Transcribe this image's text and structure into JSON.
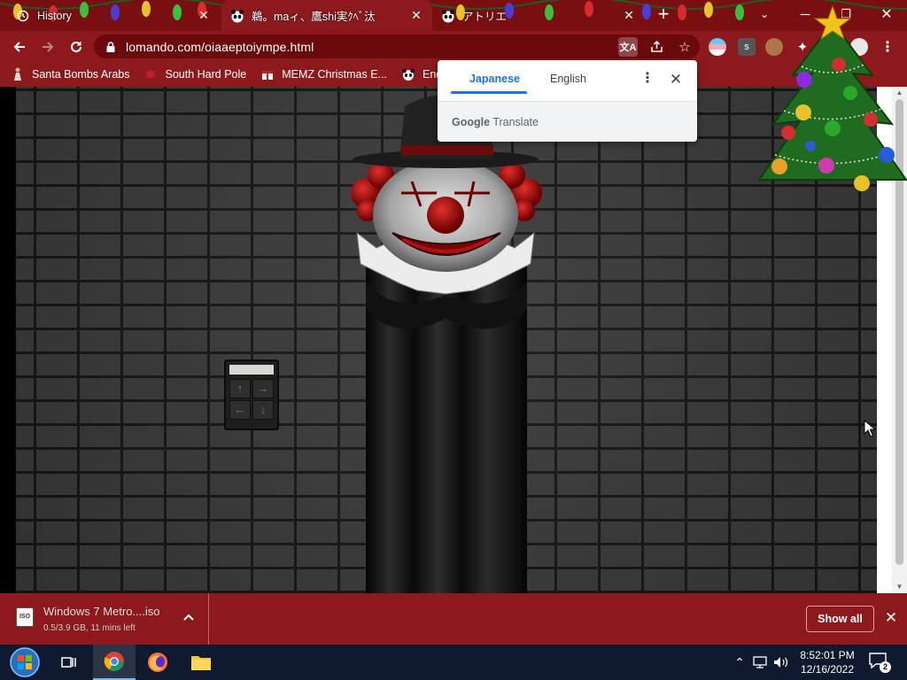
{
  "browser": {
    "tabs": [
      {
        "title": "History",
        "icon": "history-icon",
        "active": false
      },
      {
        "title": "鵜。maィ、鷹shi実ｸﾍﾞ汰",
        "icon": "panda-favicon",
        "active": true
      },
      {
        "title": "アトリエ",
        "icon": "panda-favicon",
        "active": false
      }
    ],
    "address": {
      "url": "lomando.com/oiaaeptoiympe.html"
    },
    "bookmarks": [
      {
        "label": "Santa Bombs Arabs",
        "icon": "figure-icon"
      },
      {
        "label": "South Hard Pole",
        "icon": "bug-icon"
      },
      {
        "label": "MEMZ Christmas E...",
        "icon": "gift-icon"
      },
      {
        "label": "Enderm",
        "icon": "panda-icon"
      }
    ],
    "extensions": [
      {
        "name": "profile-flag",
        "letter": ""
      },
      {
        "name": "s-extension",
        "letter": "s"
      },
      {
        "name": "avatar-extension",
        "letter": ""
      }
    ]
  },
  "translate_popup": {
    "source_lang": "Japanese",
    "target_lang": "English",
    "brand_google": "Google",
    "brand_translate": "Translate"
  },
  "game": {
    "keypad": {
      "keys": [
        "↑",
        "→",
        "←",
        "↓"
      ]
    }
  },
  "download": {
    "filename": "Windows 7 Metro....iso",
    "status": "0.5/3.9 GB, 11 mins left",
    "file_badge": "ISO",
    "show_all_label": "Show all"
  },
  "taskbar": {
    "time": "8:52:01 PM",
    "date": "12/16/2022",
    "notifications": "2",
    "apps": [
      "start-orb",
      "task-view",
      "chrome",
      "firefox",
      "file-explorer"
    ]
  },
  "colors": {
    "chrome_red": "#8c1a1c",
    "tab_strip": "#7a0f12",
    "translate_blue": "#1a73e8",
    "taskbar": "#0f1a2e"
  }
}
